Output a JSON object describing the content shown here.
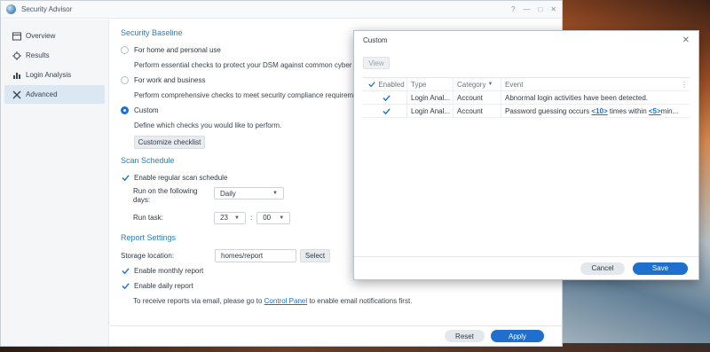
{
  "app": {
    "title": "Security Advisor",
    "window_controls": [
      "?",
      "—",
      "□",
      "✕"
    ]
  },
  "sidebar": {
    "items": [
      {
        "label": "Overview",
        "icon": "overview-icon",
        "active": false
      },
      {
        "label": "Results",
        "icon": "results-icon",
        "active": false
      },
      {
        "label": "Login Analysis",
        "icon": "chart-icon",
        "active": false
      },
      {
        "label": "Advanced",
        "icon": "tools-icon",
        "active": true
      }
    ]
  },
  "baseline": {
    "title": "Security Baseline",
    "opt_home": "For home and personal use",
    "opt_home_desc": "Perform essential checks to protect your DSM against common cyber thre",
    "opt_work": "For work and business",
    "opt_work_desc": "Perform comprehensive checks to meet security compliance requirements",
    "opt_custom": "Custom",
    "opt_custom_desc": "Define which checks you would like to perform.",
    "customize_btn": "Customize checklist"
  },
  "schedule": {
    "title": "Scan Schedule",
    "enable_label": "Enable regular scan schedule",
    "run_days_label": "Run on the following days:",
    "run_days_value": "Daily",
    "run_task_label": "Run task:",
    "hour": "23",
    "colon": ":",
    "minute": "00"
  },
  "report": {
    "title": "Report Settings",
    "storage_label": "Storage location:",
    "storage_value": "homes/report",
    "select_btn": "Select",
    "monthly_label": "Enable monthly report",
    "daily_label": "Enable daily report",
    "email_prefix": "To receive reports via email, please go to ",
    "email_link": "Control Panel",
    "email_suffix": " to enable email notifications first."
  },
  "footer": {
    "reset": "Reset",
    "apply": "Apply"
  },
  "modal": {
    "title": "Custom",
    "close": "✕",
    "view_btn": "View",
    "columns": {
      "enabled": "Enabled",
      "type": "Type",
      "category": "Category",
      "event": "Event",
      "menu": "⋮"
    },
    "rows": [
      {
        "type": "Login Anal...",
        "category": "Account",
        "event_text": "Abnormal login activities have been detected."
      },
      {
        "type": "Login Anal...",
        "category": "Account",
        "event_prefix": "Password guessing occurs ",
        "event_link1": "<10>",
        "event_mid": " times within ",
        "event_link2": "<5>",
        "event_suffix": " min..."
      }
    ],
    "cancel": "Cancel",
    "save": "Save"
  },
  "colors": {
    "accent": "#1e6fce",
    "section_title": "#2d7fc2",
    "active_sidebar": "#dbe7f3"
  }
}
